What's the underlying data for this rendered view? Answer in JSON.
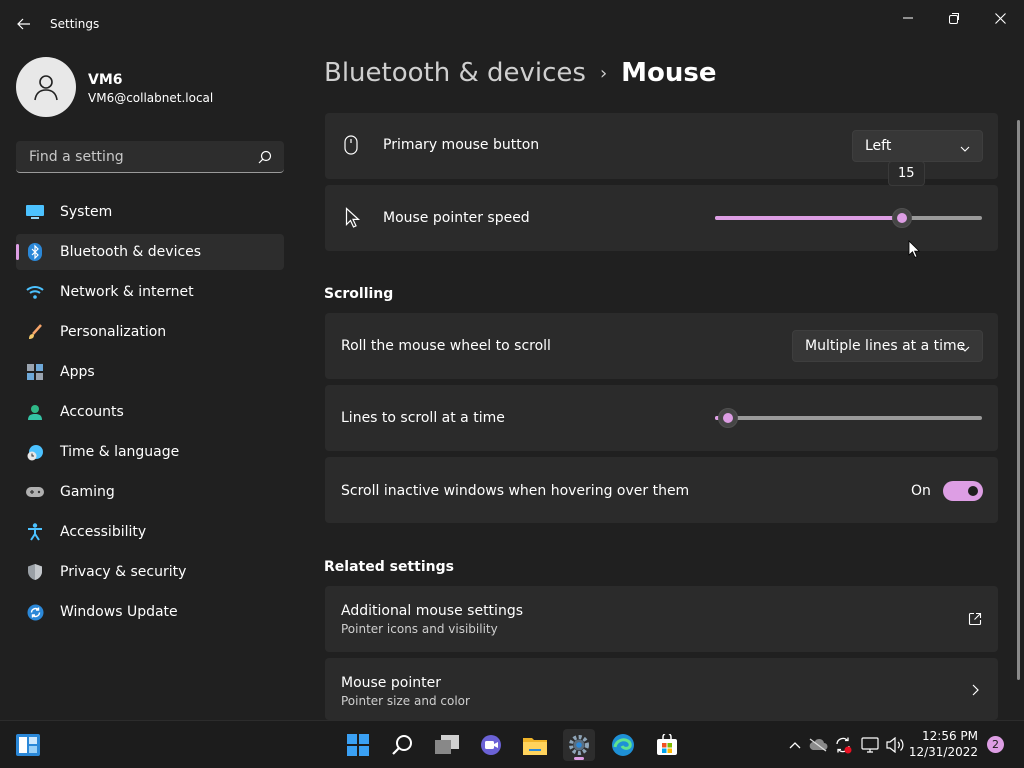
{
  "window": {
    "title": "Settings"
  },
  "profile": {
    "name": "VM6",
    "email": "VM6@collabnet.local"
  },
  "search": {
    "placeholder": "Find a setting"
  },
  "sidebar": {
    "accent": "#dd9ee4",
    "items": [
      {
        "label": "System",
        "icon": "monitor-icon"
      },
      {
        "label": "Bluetooth & devices",
        "icon": "bluetooth-icon",
        "selected": true
      },
      {
        "label": "Network & internet",
        "icon": "wifi-icon"
      },
      {
        "label": "Personalization",
        "icon": "brush-icon"
      },
      {
        "label": "Apps",
        "icon": "apps-icon"
      },
      {
        "label": "Accounts",
        "icon": "person-icon"
      },
      {
        "label": "Time & language",
        "icon": "globe-clock-icon"
      },
      {
        "label": "Gaming",
        "icon": "gamepad-icon"
      },
      {
        "label": "Accessibility",
        "icon": "accessibility-icon"
      },
      {
        "label": "Privacy & security",
        "icon": "shield-icon"
      },
      {
        "label": "Windows Update",
        "icon": "update-icon"
      }
    ]
  },
  "breadcrumb": {
    "parent": "Bluetooth & devices",
    "separator": "›",
    "current": "Mouse"
  },
  "mouse": {
    "primary_button": {
      "label": "Primary mouse button",
      "value": "Left",
      "icon": "mouse-icon"
    },
    "pointer_speed": {
      "label": "Mouse pointer speed",
      "value": "15",
      "value_fraction": 0.7,
      "icon": "pointer-icon"
    }
  },
  "scrolling": {
    "title": "Scrolling",
    "wheel": {
      "label": "Roll the mouse wheel to scroll",
      "value": "Multiple lines at a time"
    },
    "lines": {
      "label": "Lines to scroll at a time",
      "value_fraction": 0.05
    },
    "inactive": {
      "label": "Scroll inactive windows when hovering over them",
      "state": "On"
    }
  },
  "related": {
    "title": "Related settings",
    "items": [
      {
        "label": "Additional mouse settings",
        "sub": "Pointer icons and visibility",
        "icon": "external-link-icon"
      },
      {
        "label": "Mouse pointer",
        "sub": "Pointer size and color",
        "icon": "chevron-right-icon"
      }
    ]
  },
  "taskbar": {
    "clock_time": "12:56 PM",
    "clock_date": "12/31/2022",
    "notification_count": "2"
  }
}
